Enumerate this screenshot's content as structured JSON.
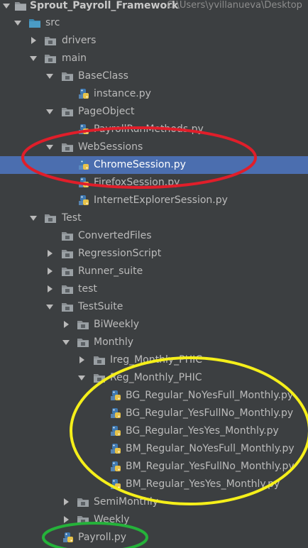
{
  "project": {
    "name": "Sprout_Payroll_Framework",
    "path": "C:\\Users\\yvillanueva\\Desktop"
  },
  "tree": {
    "src": "src",
    "drivers": "drivers",
    "main": "main",
    "BaseClass": "BaseClass",
    "instance": "instance.py",
    "PageObject": "PageObject",
    "PayrollRunMethods": "PayrollRunMethods.py",
    "WebSessions": "WebSessions",
    "ChromeSession": "ChromeSession.py",
    "FirefoxSession": "FirefoxSession.py",
    "InternetExplorerSession": "InternetExplorerSession.py",
    "Test": "Test",
    "ConvertedFiles": "ConvertedFiles",
    "RegressionScript": "RegressionScript",
    "Runner_suite": "Runner_suite",
    "test": "test",
    "TestSuite": "TestSuite",
    "BiWeekly": "BiWeekly",
    "Monthly": "Monthly",
    "Ireg_Monthly_PHIC": "Ireg_Monthly_PHIC",
    "Reg_Monthly_PHIC": "Reg_Monthly_PHIC",
    "BG_Regular_NoYesFull_Monthly": "BG_Regular_NoYesFull_Monthly.py",
    "BG_Regular_YesFullNo_Monthly": "BG_Regular_YesFullNo_Monthly.py",
    "BG_Regular_YesYes_Monthly": "BG_Regular_YesYes_Monthly.py",
    "BM_Regular_NoYesFull_Monthly": "BM_Regular_NoYesFull_Monthly.py",
    "BM_Regular_YesFullNo_Monthly": "BM_Regular_YesFullNo_Monthly.py",
    "BM_Regular_YesYes_Monthly": "BM_Regular_YesYes_Monthly.py",
    "SemiMonthly": "SemiMonthly",
    "Weekly": "Weekly",
    "Payroll": "Payroll.py"
  },
  "colors": {
    "background": "#3c3f41",
    "selection": "#4b6eaf",
    "folder": "#8a8f93",
    "source_folder": "#4a9cc6",
    "annotation_red": "#e01e2a",
    "annotation_yellow": "#f5ef1a",
    "annotation_green": "#25b23a"
  }
}
